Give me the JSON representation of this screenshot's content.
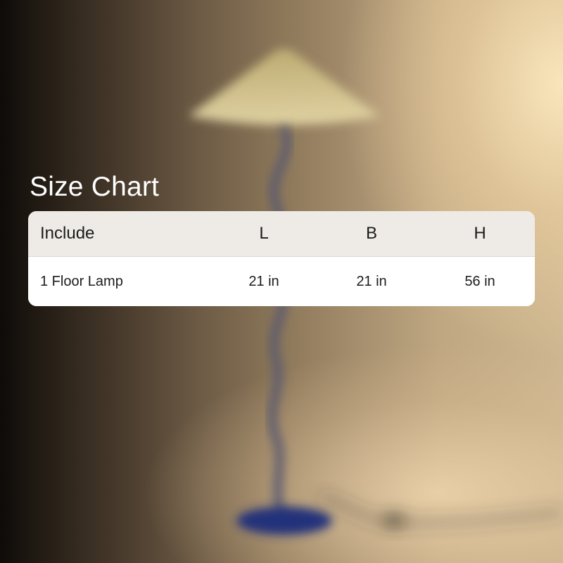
{
  "title": "Size Chart",
  "table": {
    "headers": [
      "Include",
      "L",
      "B",
      "H"
    ],
    "rows": [
      [
        "1 Floor Lamp",
        "21 in",
        "21 in",
        "56 in"
      ]
    ]
  }
}
